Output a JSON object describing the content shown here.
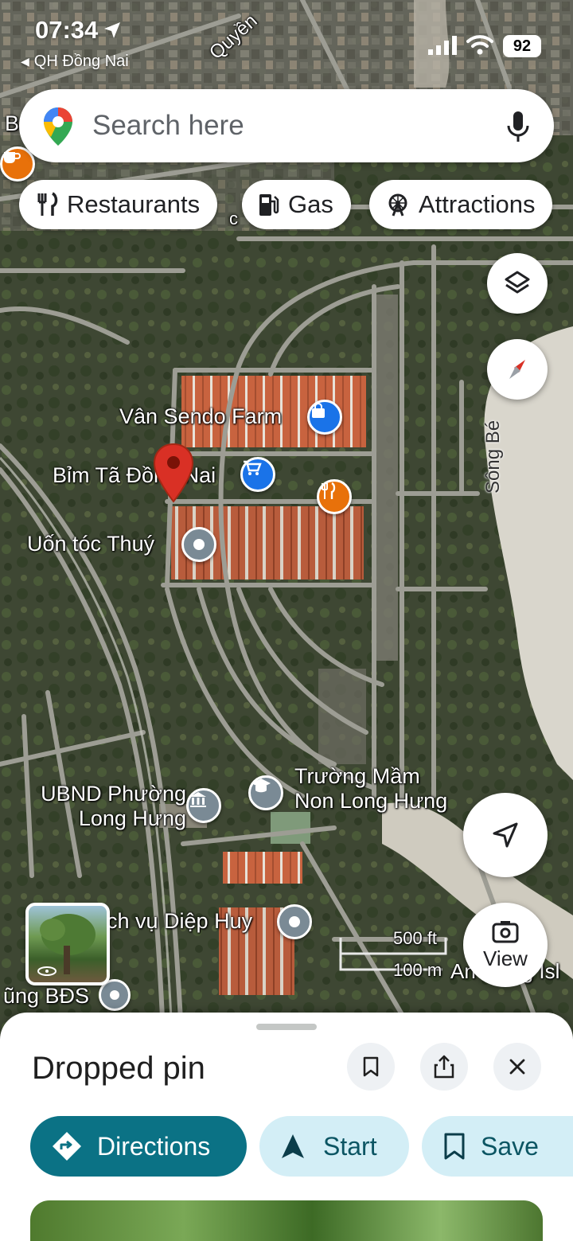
{
  "status_bar": {
    "time": "07:34",
    "back_app": "QH Đồng Nai",
    "battery": "92"
  },
  "search": {
    "placeholder": "Search here"
  },
  "chips": [
    {
      "label": "Restaurants",
      "icon": "fork-knife-icon"
    },
    {
      "label": "Gas",
      "icon": "gas-pump-icon"
    },
    {
      "label": "Attractions",
      "icon": "ferris-wheel-icon"
    }
  ],
  "map": {
    "road_labels": [
      "Quyền",
      "Sông Bé"
    ],
    "places": {
      "van_sendo_farm": "Vân Sendo Farm",
      "bim_ta": "Bỉm Tã Đồng Nai",
      "uon_toc": "Uốn tóc Thuý",
      "ubnd_line1": "UBND Phường",
      "ubnd_line2": "Long Hưng",
      "truong_line1": "Trường Mầm",
      "truong_line2": "Non Long Hưng",
      "dich_vu": "ch vụ Diệp Huy",
      "bds": "ũng BĐS",
      "an_hung": "An Hưng Isl",
      "edge_b": "B",
      "edge_c": "c"
    },
    "scale": {
      "feet": "500 ft",
      "meters": "100 m"
    },
    "pin_color": "#d93025"
  },
  "view_button": {
    "label": "View"
  },
  "sheet": {
    "title": "Dropped pin",
    "actions": {
      "directions": "Directions",
      "start": "Start",
      "save": "Save"
    }
  },
  "colors": {
    "accent": "#0b7285",
    "accent_light": "#d3eef6",
    "pin": "#d93025"
  }
}
